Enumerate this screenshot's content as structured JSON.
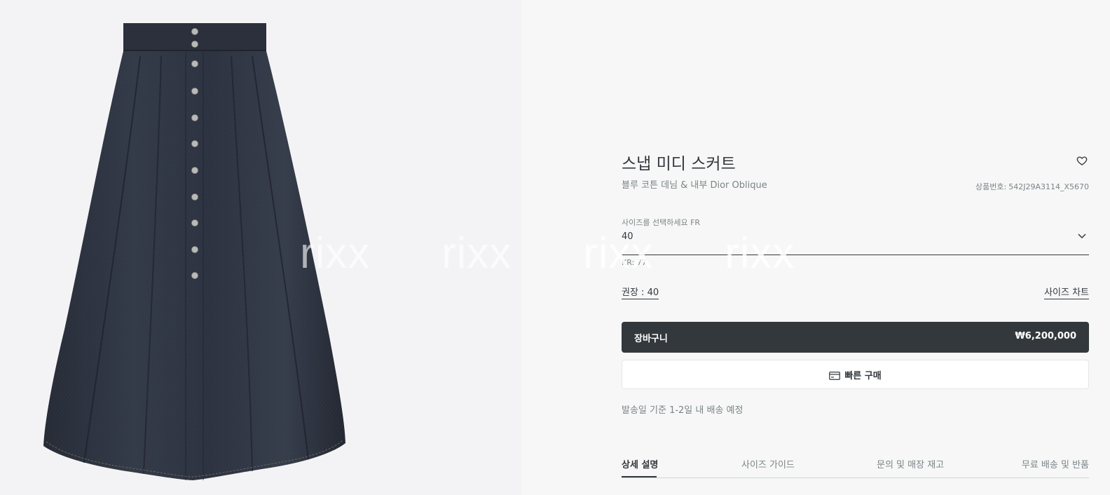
{
  "product": {
    "title": "스냅 미디 스커트",
    "subtitle": "블루 코튼 데님 & 내부 Dior Oblique",
    "sku_label": "상품번호:",
    "sku_value": "542J29A3114_X5670"
  },
  "size": {
    "label": "사이즈를 선택하세요 FR",
    "value": "40",
    "kr_note": "KR: 77",
    "recommended": "권장 : 40",
    "chart_link": "사이즈 차트"
  },
  "actions": {
    "cart_label": "장바구니",
    "cart_price": "₩6,200,000",
    "quick_buy_label": "빠른 구매"
  },
  "shipping_note": "발송일 기준 1-2일 내 배송 예정",
  "tabs": [
    {
      "label": "상세 설명",
      "active": true
    },
    {
      "label": "사이즈 가이드",
      "active": false
    },
    {
      "label": "문의 및 매장 재고",
      "active": false
    },
    {
      "label": "무료 배송 및 반품",
      "active": false
    }
  ],
  "watermark": "rixx",
  "icons": {
    "wishlist": "heart-icon",
    "dropdown": "chevron-down-icon",
    "quick_buy": "credit-card-icon"
  },
  "colors": {
    "primary": "#33383c",
    "muted": "#7b8487",
    "background": "#f7f7f7"
  }
}
